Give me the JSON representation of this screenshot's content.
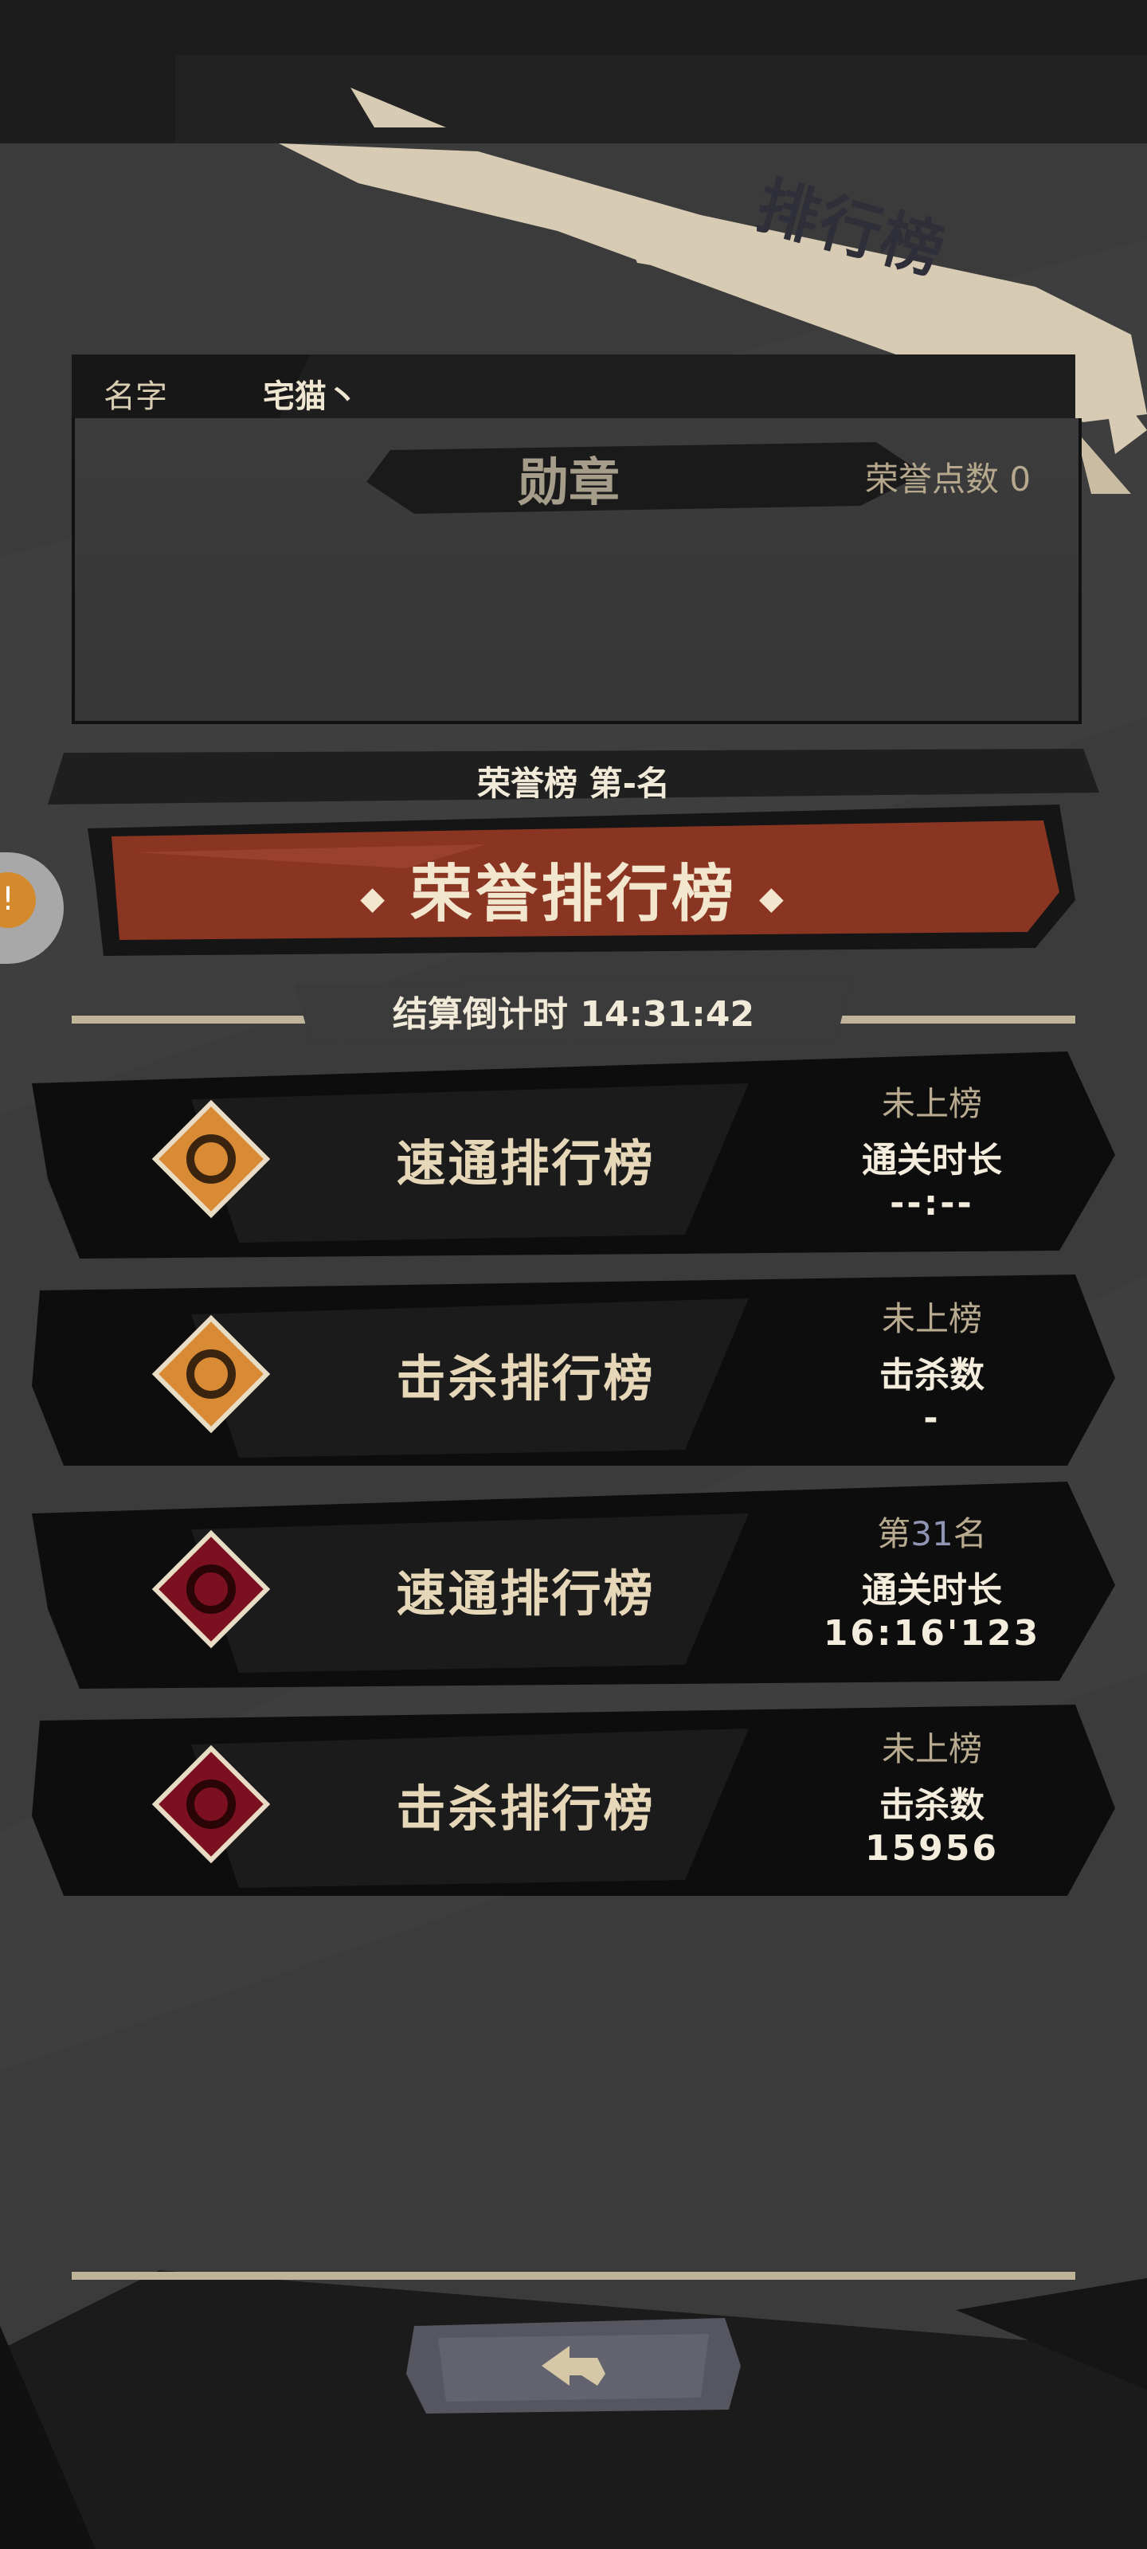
{
  "page": {
    "title": "排行榜"
  },
  "player": {
    "name_label": "名字",
    "name": "宅猫丶"
  },
  "medal": {
    "title": "勋章",
    "honor_points": "荣誉点数 0"
  },
  "honor_board": {
    "rank_text": "荣誉榜 第-名",
    "banner_label": "荣誉排行榜"
  },
  "countdown": "结算倒计时 14:31:42",
  "side_tab": {
    "glyph": "!"
  },
  "rows": [
    {
      "emblem": "orange-diamond-emblem",
      "title": "速通排行榜",
      "status": "未上榜",
      "metric": "通关时长",
      "value": "--:--"
    },
    {
      "emblem": "orange-diamond-emblem",
      "title": "击杀排行榜",
      "status": "未上榜",
      "metric": "击杀数",
      "value": "-"
    },
    {
      "emblem": "crimson-diamond-emblem",
      "title": "速通排行榜",
      "status_prefix": "第",
      "status_num": "31",
      "status_suffix": "名",
      "metric": "通关时长",
      "value": "16:16'123"
    },
    {
      "emblem": "crimson-diamond-emblem",
      "title": "击杀排行榜",
      "status": "未上榜",
      "metric": "击杀数",
      "value": "15956"
    }
  ],
  "colors": {
    "background": "#3b3b3b",
    "banner_red": "#8a3522",
    "accent_cream": "#e7d7b9",
    "row_black": "#0d0d0d"
  },
  "back_button": {
    "icon": "back-arrow-icon"
  }
}
